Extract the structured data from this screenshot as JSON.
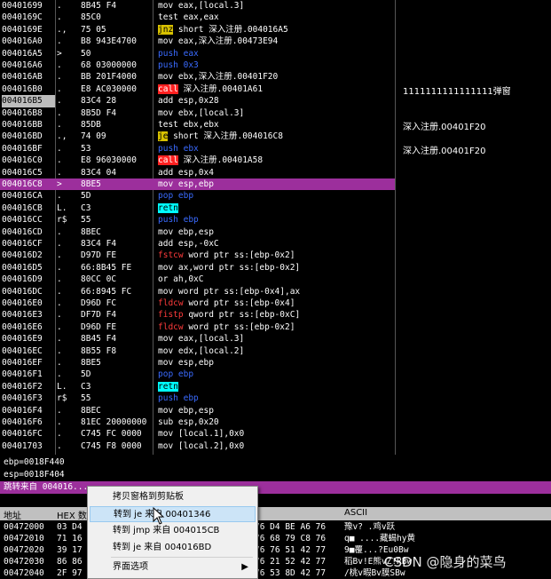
{
  "disasm_rows": [
    {
      "addr": "00401699",
      "mk": ".",
      "hex": "8B45 F4",
      "asm": [
        {
          "t": "mov eax,[local.3]"
        }
      ]
    },
    {
      "addr": "0040169C",
      "mk": ".",
      "hex": "85C0",
      "asm": [
        {
          "t": "test eax,eax"
        }
      ]
    },
    {
      "addr": "0040169E",
      "mk": ".,",
      "hex": "75 05",
      "asm": [
        {
          "t": "jnz",
          "c": "m-j"
        },
        {
          "t": " short 深入注册.004016A5"
        }
      ]
    },
    {
      "addr": "004016A0",
      "mk": ".",
      "hex": "B8 943E4700",
      "asm": [
        {
          "t": "mov eax,深入注册.00473E94"
        }
      ]
    },
    {
      "addr": "004016A5",
      "mk": ">",
      "hex": "50",
      "asm": [
        {
          "t": "push eax",
          "c": "m-blue"
        }
      ]
    },
    {
      "addr": "004016A6",
      "mk": ".",
      "hex": "68 03000000",
      "asm": [
        {
          "t": "push 0x3",
          "c": "m-blue"
        }
      ]
    },
    {
      "addr": "004016AB",
      "mk": ".",
      "hex": "BB 201F4000",
      "asm": [
        {
          "t": "mov ebx,深入注册.00401F20"
        }
      ]
    },
    {
      "addr": "004016B0",
      "mk": ".",
      "hex": "E8 AC030000",
      "asm": [
        {
          "t": "call",
          "c": "m-call"
        },
        {
          "t": " 深入注册.00401A61"
        }
      ],
      "comment": "1111111111111111弹窗"
    },
    {
      "addr": "004016B5",
      "mk": ".",
      "hex": "83C4 28",
      "asm": [
        {
          "t": "add esp,0x28"
        }
      ],
      "cur": true
    },
    {
      "addr": "004016B8",
      "mk": ".",
      "hex": "8B5D F4",
      "asm": [
        {
          "t": "mov ebx,[local.3]"
        }
      ]
    },
    {
      "addr": "004016BB",
      "mk": ".",
      "hex": "85DB",
      "asm": [
        {
          "t": "test ebx,ebx"
        }
      ],
      "comment": "深入注册.00401F20"
    },
    {
      "addr": "004016BD",
      "mk": ".,",
      "hex": "74 09",
      "asm": [
        {
          "t": "je",
          "c": "m-j"
        },
        {
          "t": " short 深入注册.004016C8"
        }
      ]
    },
    {
      "addr": "004016BF",
      "mk": ".",
      "hex": "53",
      "asm": [
        {
          "t": "push ebx",
          "c": "m-blue"
        }
      ],
      "comment": "深入注册.00401F20"
    },
    {
      "addr": "004016C0",
      "mk": ".",
      "hex": "E8 96030000",
      "asm": [
        {
          "t": "call",
          "c": "m-call"
        },
        {
          "t": " 深入注册.00401A58"
        }
      ]
    },
    {
      "addr": "004016C5",
      "mk": ".",
      "hex": "83C4 04",
      "asm": [
        {
          "t": "add esp,0x4"
        }
      ]
    },
    {
      "addr": "004016C8",
      "mk": ">",
      "hex": "8BE5",
      "asm": [
        {
          "t": "mov esp,ebp"
        }
      ],
      "hl": true
    },
    {
      "addr": "004016CA",
      "mk": ".",
      "hex": "5D",
      "asm": [
        {
          "t": "pop ebp",
          "c": "m-blue"
        }
      ]
    },
    {
      "addr": "004016CB",
      "mk": "L.",
      "hex": "C3",
      "asm": [
        {
          "t": "retn",
          "c": "m-ret"
        }
      ]
    },
    {
      "addr": "004016CC",
      "mk": "r$",
      "hex": "55",
      "asm": [
        {
          "t": "push ebp",
          "c": "m-blue"
        }
      ]
    },
    {
      "addr": "004016CD",
      "mk": ".",
      "hex": "8BEC",
      "asm": [
        {
          "t": "mov ebp,esp"
        }
      ]
    },
    {
      "addr": "004016CF",
      "mk": ".",
      "hex": "83C4 F4",
      "asm": [
        {
          "t": "add esp,-0xC"
        }
      ]
    },
    {
      "addr": "004016D2",
      "mk": ".",
      "hex": "D97D FE",
      "asm": [
        {
          "t": "fstcw",
          "c": "m-red"
        },
        {
          "t": " word ptr ss:[ebp-0x2]"
        }
      ]
    },
    {
      "addr": "004016D5",
      "mk": ".",
      "hex": "66:8B45 FE",
      "asm": [
        {
          "t": "mov ax,word ptr ss:[ebp-0x2]"
        }
      ]
    },
    {
      "addr": "004016D9",
      "mk": ".",
      "hex": "80CC 0C",
      "asm": [
        {
          "t": "or ah,0xC"
        }
      ]
    },
    {
      "addr": "004016DC",
      "mk": ".",
      "hex": "66:8945 FC",
      "asm": [
        {
          "t": "mov word ptr ss:[ebp-0x4],ax"
        }
      ]
    },
    {
      "addr": "004016E0",
      "mk": ".",
      "hex": "D96D FC",
      "asm": [
        {
          "t": "fldcw",
          "c": "m-red"
        },
        {
          "t": " word ptr ss:[ebp-0x4]"
        }
      ]
    },
    {
      "addr": "004016E3",
      "mk": ".",
      "hex": "DF7D F4",
      "asm": [
        {
          "t": "fistp",
          "c": "m-red"
        },
        {
          "t": " qword ptr ss:[ebp-0xC]"
        }
      ]
    },
    {
      "addr": "004016E6",
      "mk": ".",
      "hex": "D96D FE",
      "asm": [
        {
          "t": "fldcw",
          "c": "m-red"
        },
        {
          "t": " word ptr ss:[ebp-0x2]"
        }
      ]
    },
    {
      "addr": "004016E9",
      "mk": ".",
      "hex": "8B45 F4",
      "asm": [
        {
          "t": "mov eax,[local.3]"
        }
      ]
    },
    {
      "addr": "004016EC",
      "mk": ".",
      "hex": "8B55 F8",
      "asm": [
        {
          "t": "mov edx,[local.2]"
        }
      ]
    },
    {
      "addr": "004016EF",
      "mk": ".",
      "hex": "8BE5",
      "asm": [
        {
          "t": "mov esp,ebp"
        }
      ]
    },
    {
      "addr": "004016F1",
      "mk": ".",
      "hex": "5D",
      "asm": [
        {
          "t": "pop ebp",
          "c": "m-blue"
        }
      ]
    },
    {
      "addr": "004016F2",
      "mk": "L.",
      "hex": "C3",
      "asm": [
        {
          "t": "retn",
          "c": "m-ret"
        }
      ]
    },
    {
      "addr": "004016F3",
      "mk": "r$",
      "hex": "55",
      "asm": [
        {
          "t": "push ebp",
          "c": "m-blue"
        }
      ]
    },
    {
      "addr": "004016F4",
      "mk": ".",
      "hex": "8BEC",
      "asm": [
        {
          "t": "mov ebp,esp"
        }
      ]
    },
    {
      "addr": "004016F6",
      "mk": ".",
      "hex": "81EC 20000000",
      "asm": [
        {
          "t": "sub esp,0x20"
        }
      ]
    },
    {
      "addr": "004016FC",
      "mk": ".",
      "hex": "C745 FC 0000",
      "asm": [
        {
          "t": "mov [local.1],0x0"
        }
      ]
    },
    {
      "addr": "00401703",
      "mk": ".",
      "hex": "C745 F8 0000",
      "asm": [
        {
          "t": "mov [local.2],0x0"
        }
      ]
    }
  ],
  "registers": {
    "line1": "ebp=0018F440",
    "line2": "esp=0018F404",
    "jump_line": "跳转来自 004016..."
  },
  "dump": {
    "headers": {
      "addr": "地址",
      "hex": "HEX 数据",
      "ascii": "ASCII"
    },
    "rows": [
      {
        "addr": "00472000",
        "h1": "03 D4",
        "h2": "76 D4 BE A6 76",
        "s": "豫v? .鸡v跃"
      },
      {
        "addr": "00472010",
        "h1": "71 16",
        "h2": "76 68 79 C8 76",
        "s": "q■ ....藏蝎hy黄"
      },
      {
        "addr": "00472020",
        "h1": "39 17",
        "h2": "76 76 51 42 77",
        "s": "9■覆...?Eu0Bw"
      },
      {
        "addr": "00472030",
        "h1": "86 86",
        "h2": "76 21 52 42 77",
        "s": "稻Bv!E熊vZ!RBw"
      },
      {
        "addr": "00472040",
        "h1": "2F 97",
        "h2": "76 53 8D 42 77",
        "s": "/桃v暇Bv膜SBw"
      }
    ]
  },
  "context_menu": {
    "items": [
      {
        "label": "拷贝窗格到剪贴板",
        "name": "menu-copy-pane"
      },
      {
        "label": "转到 je 来自 00401346",
        "name": "menu-goto-je-00401346",
        "sel": true
      },
      {
        "label": "转到 jmp 来自 004015CB",
        "name": "menu-goto-jmp-004015cb"
      },
      {
        "label": "转到 je 来自 004016BD",
        "name": "menu-goto-je-004016bd"
      },
      {
        "label": "界面选项",
        "name": "menu-interface-options",
        "arrow": "▶"
      }
    ]
  },
  "watermark": "CSDN @隐身的菜鸟"
}
